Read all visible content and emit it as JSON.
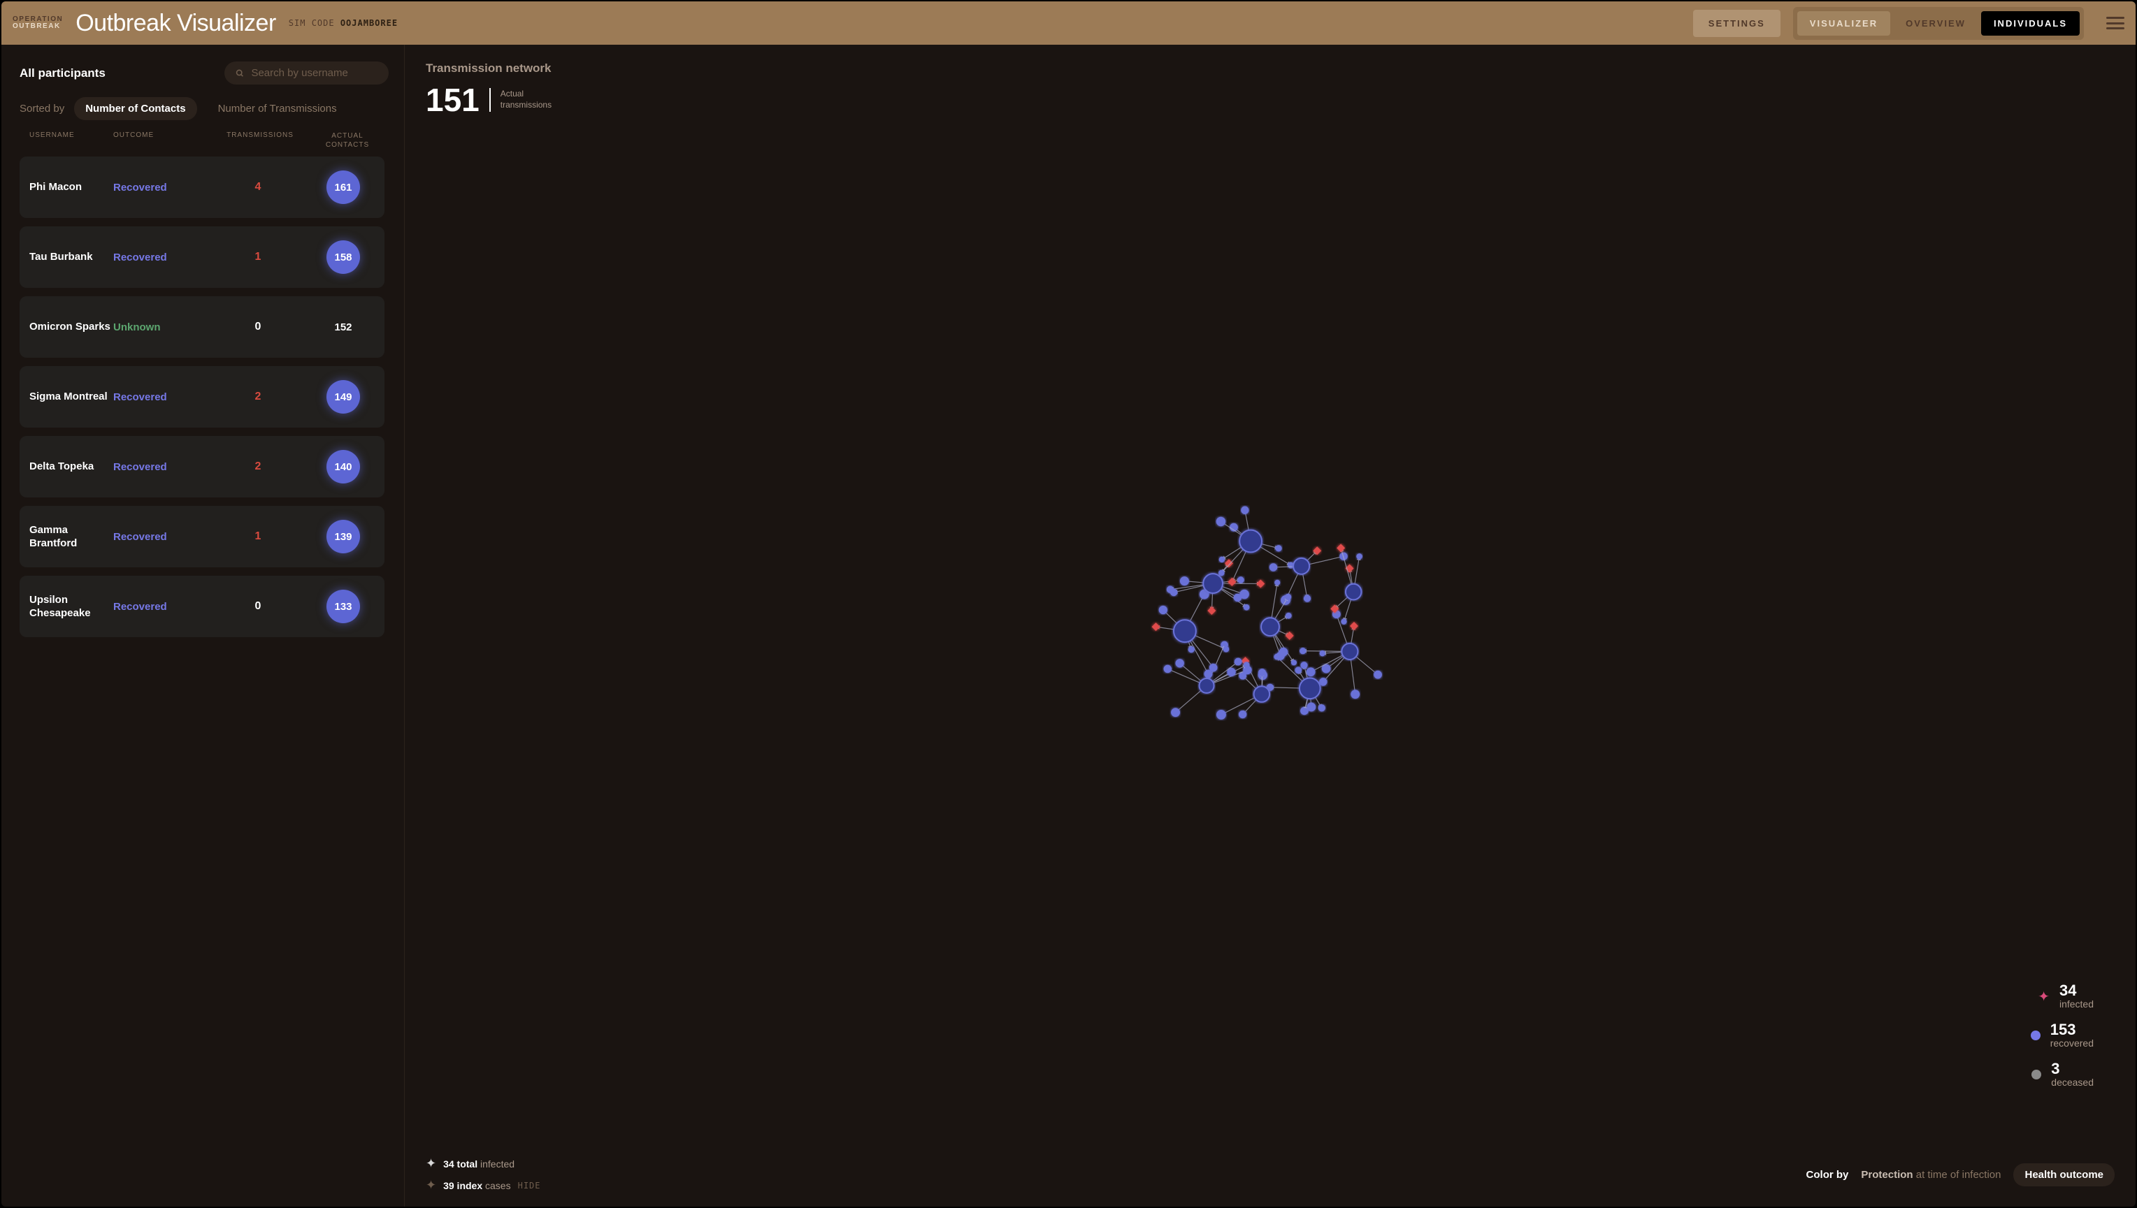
{
  "header": {
    "logo_line1": "OPERATION",
    "logo_line2": "OUTBREAK",
    "title": "Outbreak Visualizer",
    "simcode_label": "SIM CODE",
    "simcode_value": "OOJAMBOREE",
    "settings": "SETTINGS",
    "tabs": {
      "visualizer": "VISUALIZER",
      "overview": "OVERVIEW",
      "individuals": "INDIVIDUALS"
    }
  },
  "sidebar": {
    "title": "All participants",
    "search_placeholder": "Search by username",
    "sorted_by": "Sorted by",
    "sort_contacts": "Number of Contacts",
    "sort_transmissions": "Number of Transmissions",
    "cols": {
      "username": "USERNAME",
      "outcome": "OUTCOME",
      "transmissions": "TRANSMISSIONS",
      "contacts": "ACTUAL CONTACTS"
    },
    "rows": [
      {
        "name": "Phi Macon",
        "outcome": "Recovered",
        "outcome_class": "recovered",
        "tx": "4",
        "tx_zero": false,
        "contacts": "161",
        "badge": true
      },
      {
        "name": "Tau Burbank",
        "outcome": "Recovered",
        "outcome_class": "recovered",
        "tx": "1",
        "tx_zero": false,
        "contacts": "158",
        "badge": true
      },
      {
        "name": "Omicron Sparks",
        "outcome": "Unknown",
        "outcome_class": "unknown",
        "tx": "0",
        "tx_zero": true,
        "contacts": "152",
        "badge": false
      },
      {
        "name": "Sigma Montreal",
        "outcome": "Recovered",
        "outcome_class": "recovered",
        "tx": "2",
        "tx_zero": false,
        "contacts": "149",
        "badge": true
      },
      {
        "name": "Delta Topeka",
        "outcome": "Recovered",
        "outcome_class": "recovered",
        "tx": "2",
        "tx_zero": false,
        "contacts": "140",
        "badge": true
      },
      {
        "name": "Gamma Brantford",
        "outcome": "Recovered",
        "outcome_class": "recovered",
        "tx": "1",
        "tx_zero": false,
        "contacts": "139",
        "badge": true
      },
      {
        "name": "Upsilon Chesapeake",
        "outcome": "Recovered",
        "outcome_class": "recovered",
        "tx": "0",
        "tx_zero": true,
        "contacts": "133",
        "badge": true
      }
    ]
  },
  "main": {
    "title": "Transmission network",
    "count": "151",
    "count_label1": "Actual",
    "count_label2": "transmissions",
    "legend": {
      "infected_n": "34",
      "infected_l": "infected",
      "recovered_n": "153",
      "recovered_l": "recovered",
      "deceased_n": "3",
      "deceased_l": "deceased"
    },
    "footer": {
      "total_n": "34 total",
      "total_l": "infected",
      "index_n": "39 index",
      "index_l": "cases",
      "hide": "HIDE",
      "color_by": "Color by",
      "protection_b": "Protection",
      "protection_l": "at time of infection",
      "health": "Health outcome"
    }
  },
  "colors": {
    "recovered": "#7678e6",
    "infected": "#d94b7a",
    "deceased": "#8a8a8a"
  }
}
